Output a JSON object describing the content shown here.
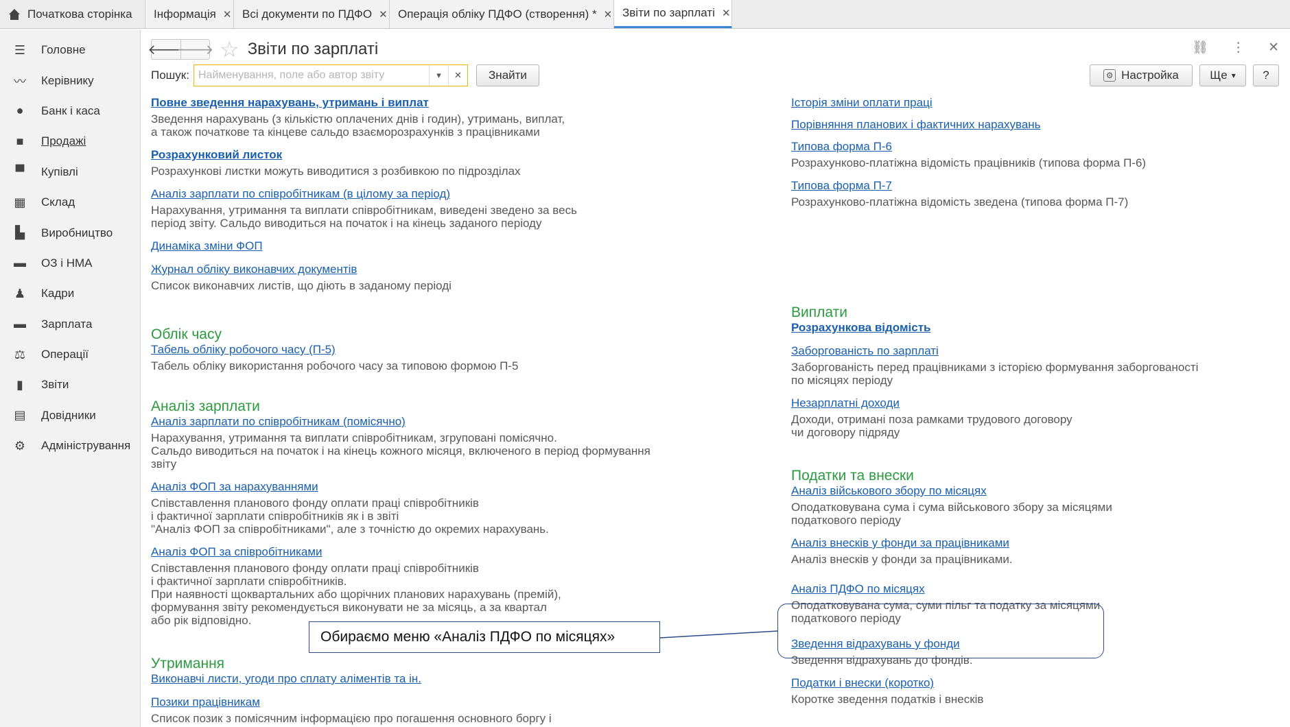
{
  "tabs": [
    {
      "label": "Початкова сторінка",
      "home": true
    },
    {
      "label": "Інформація"
    },
    {
      "label": "Всі документи по ПДФО"
    },
    {
      "label": "Операція обліку ПДФО (створення) *"
    },
    {
      "label": "Звіти по зарплаті",
      "active": true
    }
  ],
  "sidebar": {
    "items": [
      {
        "label": "Головне",
        "icon": "menu-lines-icon"
      },
      {
        "label": "Керівнику",
        "icon": "trend-icon"
      },
      {
        "label": "Банк і каса",
        "icon": "coin-icon"
      },
      {
        "label": "Продажі",
        "icon": "bag-icon"
      },
      {
        "label": "Купівлі",
        "icon": "cart-icon"
      },
      {
        "label": "Склад",
        "icon": "grid-icon"
      },
      {
        "label": "Виробництво",
        "icon": "factory-icon"
      },
      {
        "label": "ОЗ і НМА",
        "icon": "truck-icon"
      },
      {
        "label": "Кадри",
        "icon": "person-icon"
      },
      {
        "label": "Зарплата",
        "icon": "wallet-icon"
      },
      {
        "label": "Операції",
        "icon": "balance-icon"
      },
      {
        "label": "Звіти",
        "icon": "bar-chart-icon"
      },
      {
        "label": "Довідники",
        "icon": "book-icon"
      },
      {
        "label": "Адміністрування",
        "icon": "gear-icon"
      }
    ]
  },
  "header": {
    "title": "Звіти по зарплаті",
    "search_label": "Пошук:",
    "search_placeholder": "Найменування, поле або автор звіту",
    "find_label": "Знайти",
    "settings_label": "Настройка",
    "more_label": "Ще",
    "help_label": "?"
  },
  "left": {
    "top_entries": [
      {
        "link": "Повне зведення нарахувань, утримань і виплат",
        "bold": true,
        "desc": "Зведення нарахувань (з кількістю оплачених днів і годин), утримань, виплат,\nа також початкове та кінцеве сальдо взаєморозрахунків з працівниками"
      },
      {
        "link": "Розрахунковий листок",
        "bold": true,
        "desc": "Розрахункові листки можуть виводитися з розбивкою по підрозділах"
      },
      {
        "link": "Аналіз зарплати по співробітникам (в цілому за період)",
        "desc": "Нарахування, утримання та виплати співробітникам, виведені зведено за весь\nперіод звіту. Сальдо виводиться на початок і на кінець заданого періоду"
      },
      {
        "link": "Динаміка зміни ФОП",
        "desc": ""
      },
      {
        "link": "Журнал обліку виконавчих документів",
        "desc": "Список виконавчих листів, що діють в заданому періоді"
      }
    ],
    "section_time": {
      "title": "Облік часу",
      "entries": [
        {
          "link": "Табель обліку робочого часу (П-5)",
          "desc": "Табель обліку використання робочого часу за типовою формою П-5"
        }
      ]
    },
    "section_analysis": {
      "title": "Аналіз зарплати",
      "entries": [
        {
          "link": "Аналіз зарплати по співробітникам (помісячно)",
          "desc": "Нарахування, утримання та виплати співробітникам, згруповані помісячно.\nСальдо виводиться на початок і на кінець кожного місяця, включеного в період формування звіту"
        },
        {
          "link": "Аналіз ФОП за нарахуваннями",
          "desc": "Співставлення планового фонду оплати праці співробітників\nі фактичної зарплати співробітників як і в звіті\n\"Аналіз ФОП за співробітниками\", але з точністю до окремих нарахувань."
        },
        {
          "link": "Аналіз ФОП за співробітниками",
          "desc": "Співставлення планового фонду оплати праці співробітників\nі фактичної зарплати співробітників.\nПри наявності щоквартальних або щорічних планових нарахувань (премій),\nформування звіту рекомендується виконувати не за місяць, а за квартал\nабо рік відповідно."
        }
      ]
    },
    "section_deductions": {
      "title": "Утримання",
      "entries": [
        {
          "link": "Виконавчі листи, угоди про сплату аліментів та ін.",
          "desc": ""
        },
        {
          "link": "Позики працівникам",
          "desc": "Список позик з помісячним інформацією про погашення основного боргу і"
        }
      ]
    }
  },
  "right": {
    "top_entries": [
      {
        "link": "Історія зміни оплати праці",
        "desc": ""
      },
      {
        "link": "Порівняння планових і фактичних нарахувань",
        "desc": ""
      },
      {
        "link": "Типова форма П-6",
        "desc": "Розрахунково-платіжна відомість працівників (типова форма П-6)"
      },
      {
        "link": "Типова форма П-7",
        "desc": "Розрахунково-платіжна відомість зведена (типова форма П-7)"
      }
    ],
    "section_payments": {
      "title": "Виплати",
      "entries": [
        {
          "link": "Розрахункова відомість",
          "bold": true,
          "desc": ""
        },
        {
          "link": "Заборгованість по зарплаті",
          "desc": "Заборгованість перед працівниками з історією формування заборгованості\nпо місяцях періоду"
        },
        {
          "link": "Незарплатні доходи",
          "desc": "Доходи, отримані поза рамками трудового договору\nчи договору підряду"
        }
      ]
    },
    "section_taxes": {
      "title": "Податки та внески",
      "entries": [
        {
          "link": "Аналіз військового збору по місяцях",
          "desc": "Оподатковувана сума і сума військового збору за місяцями\nподаткового періоду"
        },
        {
          "link": "Аналіз внесків у фонди за працівниками",
          "desc": "Аналіз внесків у фонди за працівниками."
        },
        {
          "link": "Аналіз ПДФО по місяцях",
          "desc": "Оподатковувана сума, суми пільг та податку за місяцями\nподаткового періоду"
        },
        {
          "link": "Зведення відрахувань у фонди",
          "desc": "Зведення відрахувань до фондів."
        },
        {
          "link": "Податки і внески (коротко)",
          "desc": "Коротке зведення податків і внесків"
        }
      ]
    }
  },
  "callout": {
    "text": "Обираємо меню «Аналіз ПДФО по місяцях»"
  }
}
